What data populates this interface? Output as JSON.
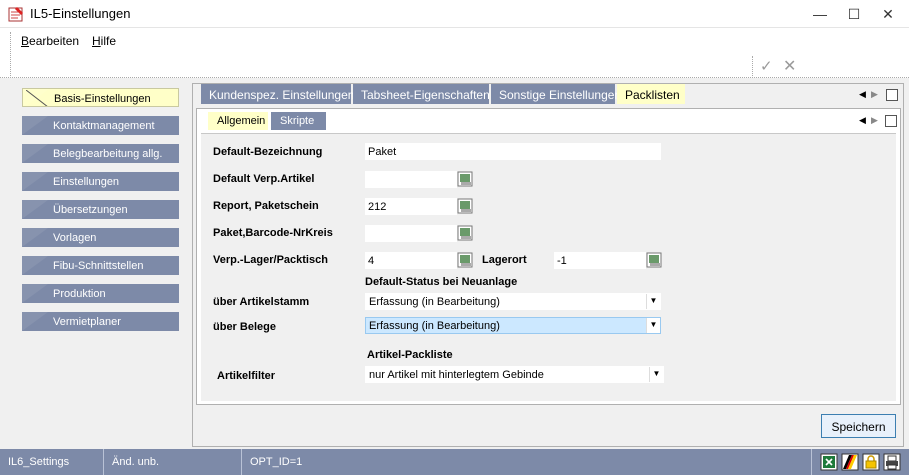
{
  "window": {
    "title": "IL5-Einstellungen"
  },
  "menu": {
    "bearbeiten": "Bearbeiten",
    "bearbeiten_rest": "earbeiten",
    "hilfe_rest": "ilfe"
  },
  "sidebar": {
    "items": [
      {
        "label": "Basis-Einstellungen",
        "active": true
      },
      {
        "label": "Kontaktmanagement"
      },
      {
        "label": "Belegbearbeitung allg."
      },
      {
        "label": "Einstellungen"
      },
      {
        "label": "Übersetzungen"
      },
      {
        "label": "Vorlagen"
      },
      {
        "label": "Fibu-Schnittstellen"
      },
      {
        "label": "Produktion"
      },
      {
        "label": "Vermietplaner"
      }
    ]
  },
  "tabs": {
    "main": [
      {
        "label": "Kundenspez. Einstellungen"
      },
      {
        "label": "Tabsheet-Eigenschaften"
      },
      {
        "label": "Sonstige Einstellungen"
      },
      {
        "label": "Packlisten",
        "active": true
      }
    ],
    "sub": [
      {
        "label": "Allgemein",
        "active": true
      },
      {
        "label": "Skripte"
      }
    ]
  },
  "form": {
    "default_bezeichnung": {
      "label": "Default-Bezeichnung",
      "value": "Paket"
    },
    "default_verp_artikel": {
      "label": "Default Verp.Artikel",
      "value": ""
    },
    "report_paketschein": {
      "label": "Report, Paketschein",
      "value": "212"
    },
    "paket_barcode": {
      "label": "Paket,Barcode-NrKreis",
      "value": ""
    },
    "verp_lager": {
      "label": "Verp.-Lager/Packtisch",
      "value": "4"
    },
    "lagerort": {
      "label": "Lagerort",
      "value": "-1"
    },
    "status_heading": "Default-Status bei Neuanlage",
    "ueber_artikelstamm": {
      "label": "über Artikelstamm",
      "value": "Erfassung (in Bearbeitung)"
    },
    "ueber_belege": {
      "label": "über Belege",
      "value": "Erfassung (in Bearbeitung)"
    },
    "packliste_heading": "Artikel-Packliste",
    "artikelfilter": {
      "label": "Artikelfilter",
      "value": "nur Artikel mit hinterlegtem Gebinde"
    }
  },
  "buttons": {
    "save": "Speichern"
  },
  "statusbar": {
    "settings": "IL6_Settings",
    "changed": "Änd. unb.",
    "opt_id": "OPT_ID=1"
  },
  "colors": {
    "tab_blue": "#7d8aa8",
    "tab_active": "#ffffc8",
    "selection": "#cce8ff"
  },
  "icons": [
    "app-icon",
    "minimize-icon",
    "maximize-icon",
    "close-icon",
    "check-icon",
    "cancel-icon",
    "picker-icon",
    "dropdown-arrow-icon",
    "excel-icon",
    "german-flag-icon",
    "lock-icon",
    "printer-icon"
  ]
}
